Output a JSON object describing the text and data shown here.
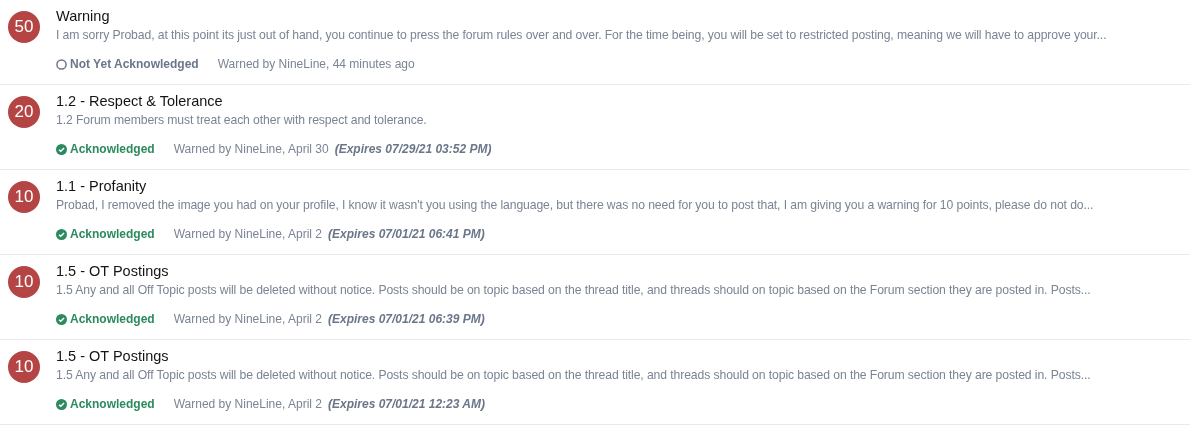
{
  "warnings": [
    {
      "points": "50",
      "title": "Warning",
      "description": "I am sorry Probad, at this point its just out of hand, you continue to press the forum rules over and over. For the time being, you will be set to restricted posting, meaning we will have to approve your...",
      "acknowledged": false,
      "status": "Not Yet Acknowledged",
      "warned_by": "Warned by NineLine, 44 minutes ago"
    },
    {
      "points": "20",
      "title": "1.2 - Respect & Tolerance",
      "description": "1.2 Forum members must treat each other with respect and tolerance.",
      "acknowledged": true,
      "status": "Acknowledged",
      "warned_by": "Warned by NineLine, April 30",
      "expires": "(Expires 07/29/21 03:52 PM)"
    },
    {
      "points": "10",
      "title": "1.1 - Profanity",
      "description": "Probad, I removed the image you had on your profile, I know it wasn't you using the language, but there was no need for you to post that, I am giving you a warning for 10 points, please do not do...",
      "acknowledged": true,
      "status": "Acknowledged",
      "warned_by": "Warned by NineLine, April 2",
      "expires": "(Expires 07/01/21 06:41 PM)"
    },
    {
      "points": "10",
      "title": "1.5 - OT Postings",
      "description": "1.5 Any and all Off Topic posts will be deleted without notice. Posts should be on topic based on the thread title, and threads should on topic based on the Forum section they are posted in. Posts...",
      "acknowledged": true,
      "status": "Acknowledged",
      "warned_by": "Warned by NineLine, April 2",
      "expires": "(Expires 07/01/21 06:39 PM)"
    },
    {
      "points": "10",
      "title": "1.5 - OT Postings",
      "description": "1.5 Any and all Off Topic posts will be deleted without notice. Posts should be on topic based on the thread title, and threads should on topic based on the Forum section they are posted in. Posts...",
      "acknowledged": true,
      "status": "Acknowledged",
      "warned_by": "Warned by NineLine, April 2",
      "expires": "(Expires 07/01/21 12:23 AM)"
    }
  ]
}
